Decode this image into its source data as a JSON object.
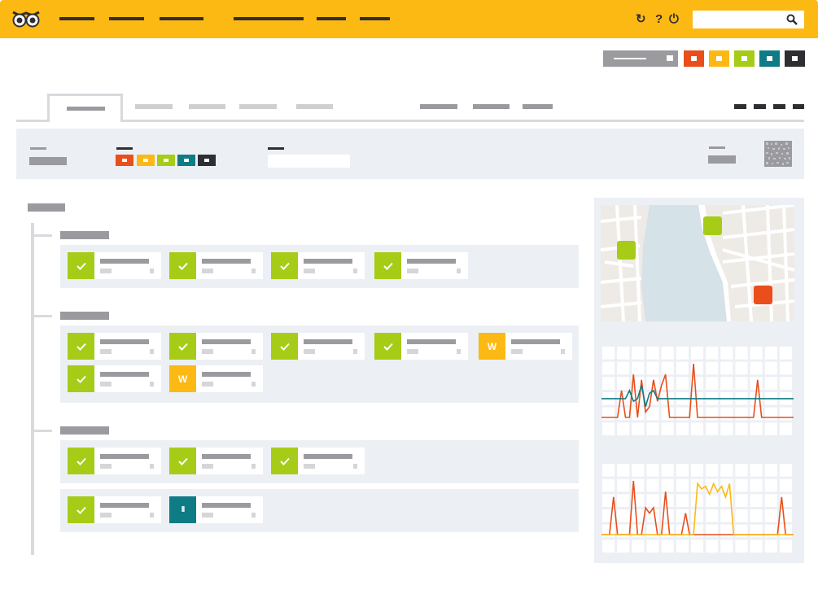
{
  "app": {
    "logo": "owl-logo-icon",
    "colors": {
      "brand": "#fdb913",
      "dark": "#2f2f33",
      "ok": "#a6cc17",
      "warn": "#fdb913",
      "error": "#e94e1b",
      "pause": "#0f7b85",
      "panel": "#ecf0f4"
    }
  },
  "topbar": {
    "icons": {
      "refresh": "↻",
      "help": "?",
      "power": "⏻",
      "search": "⚲"
    }
  },
  "cards": {
    "warn_label": "W",
    "pause_label": "II"
  },
  "chart_data": [
    {
      "type": "line",
      "series": [
        {
          "color": "#e94e1b",
          "values": [
            0,
            0,
            0,
            0,
            0,
            0.5,
            0,
            0,
            0.8,
            0,
            0.7,
            0.1,
            0.2,
            0.7,
            0.3,
            0.6,
            0.8,
            0,
            0,
            0,
            0,
            0,
            0,
            1.0,
            0,
            0,
            0,
            0,
            0,
            0,
            0,
            0,
            0,
            0,
            0,
            0,
            0,
            0,
            0,
            0.7,
            0,
            0,
            0,
            0,
            0,
            0,
            0,
            0,
            0
          ]
        },
        {
          "color": "#0f7b85",
          "values": [
            0.35,
            0.35,
            0.35,
            0.35,
            0.35,
            0.35,
            0.35,
            0.5,
            0.3,
            0.35,
            0.6,
            0.2,
            0.45,
            0.5,
            0.35,
            0.35,
            0.35,
            0.35,
            0.35,
            0.35,
            0.35,
            0.35,
            0.35,
            0.35,
            0.35,
            0.35,
            0.35,
            0.35,
            0.35,
            0.35,
            0.35,
            0.35,
            0.35,
            0.35,
            0.35,
            0.35,
            0.35,
            0.35,
            0.35,
            0.35,
            0.35,
            0.35,
            0.35,
            0.35,
            0.35,
            0.35,
            0.35,
            0.35,
            0.35
          ]
        }
      ]
    },
    {
      "type": "line",
      "series": [
        {
          "color": "#e94e1b",
          "values": [
            0,
            0,
            0,
            0.7,
            0,
            0,
            0,
            0,
            1.0,
            0,
            0,
            0.5,
            0.4,
            0.5,
            0,
            0,
            0.8,
            0,
            0,
            0,
            0,
            0.4,
            0,
            0,
            0,
            0,
            0,
            0,
            0,
            0,
            0,
            0,
            0,
            0,
            0,
            0,
            0,
            0,
            0,
            0,
            0,
            0,
            0,
            0,
            0,
            0.7,
            0,
            0,
            0
          ]
        },
        {
          "color": "#fdb913",
          "values": [
            0,
            0,
            0,
            0,
            0,
            0,
            0,
            0,
            0,
            0,
            0,
            0,
            0,
            0,
            0,
            0,
            0,
            0,
            0,
            0,
            0,
            0,
            0,
            0,
            0.95,
            0.85,
            0.9,
            0.75,
            0.95,
            0.8,
            0.9,
            0.7,
            0.95,
            0,
            0,
            0,
            0,
            0,
            0,
            0,
            0,
            0,
            0,
            0,
            0,
            0,
            0,
            0,
            0
          ]
        }
      ]
    }
  ]
}
